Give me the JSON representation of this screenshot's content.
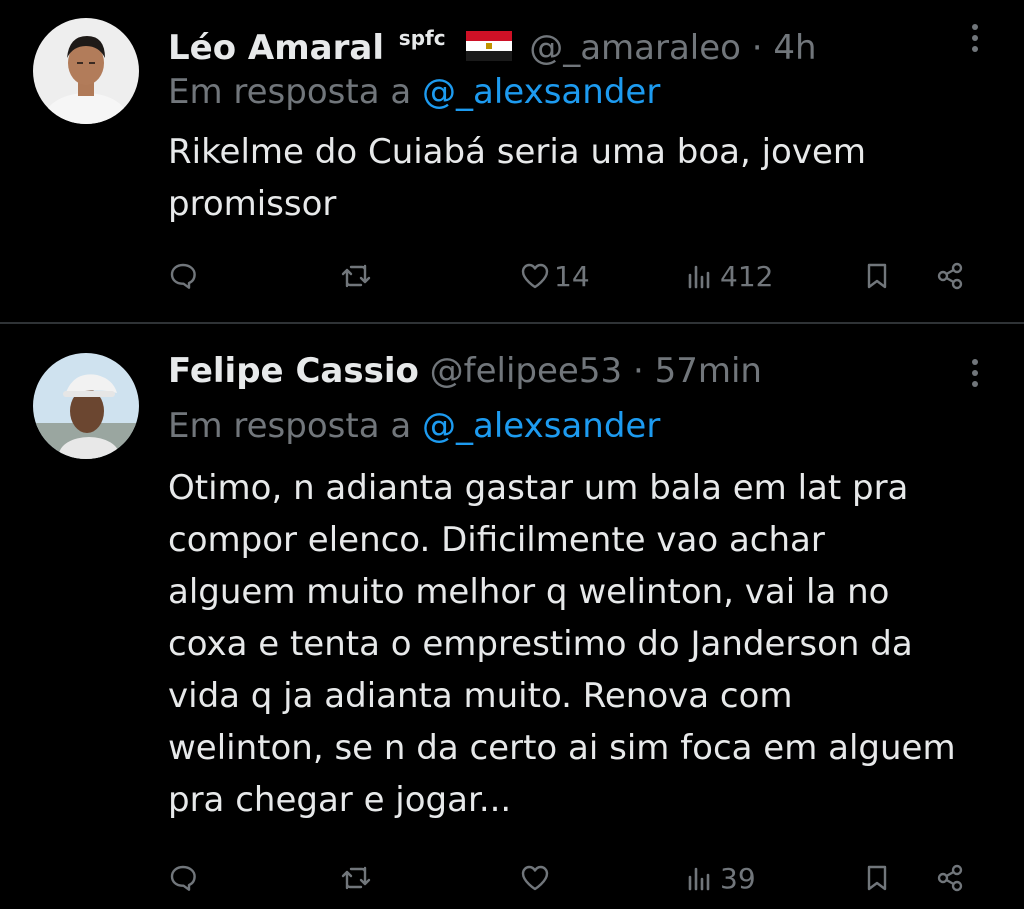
{
  "tweets": [
    {
      "name": "Léo Amaral",
      "badge": "spfc",
      "handle": "@_amaraleo",
      "separator": "·",
      "time": "4h",
      "reply_prefix": "Em resposta a",
      "reply_to": "@_alexsander",
      "body_lines": [
        "Rikelme do Cuiabá seria uma boa, jovem",
        "promissor"
      ],
      "likes": "14",
      "views": "412",
      "avatar_icon": "user-avatar-photo",
      "flag_icon": "egypt-flag-icon"
    },
    {
      "name": "Felipe Cassio",
      "handle": "@felipee53",
      "separator": "·",
      "time": "57min",
      "reply_prefix": "Em resposta a",
      "reply_to": "@_alexsander",
      "body_lines": [
        "Otimo, n adianta gastar um bala em lat pra",
        "compor elenco. Dificilmente vao achar",
        "alguem muito melhor q welinton, vai la no",
        "coxa e tenta o emprestimo do Janderson da",
        "vida q ja adianta muito. Renova com",
        "welinton, se n da certo ai sim foca em alguem",
        "pra chegar e jogar..."
      ],
      "likes": "",
      "views": "39",
      "avatar_icon": "user-avatar-photo"
    }
  ],
  "colors": {
    "background": "#000000",
    "text": "#e7e9ea",
    "muted": "#71767b",
    "link": "#1d9bf0",
    "divider": "#2f3336"
  }
}
